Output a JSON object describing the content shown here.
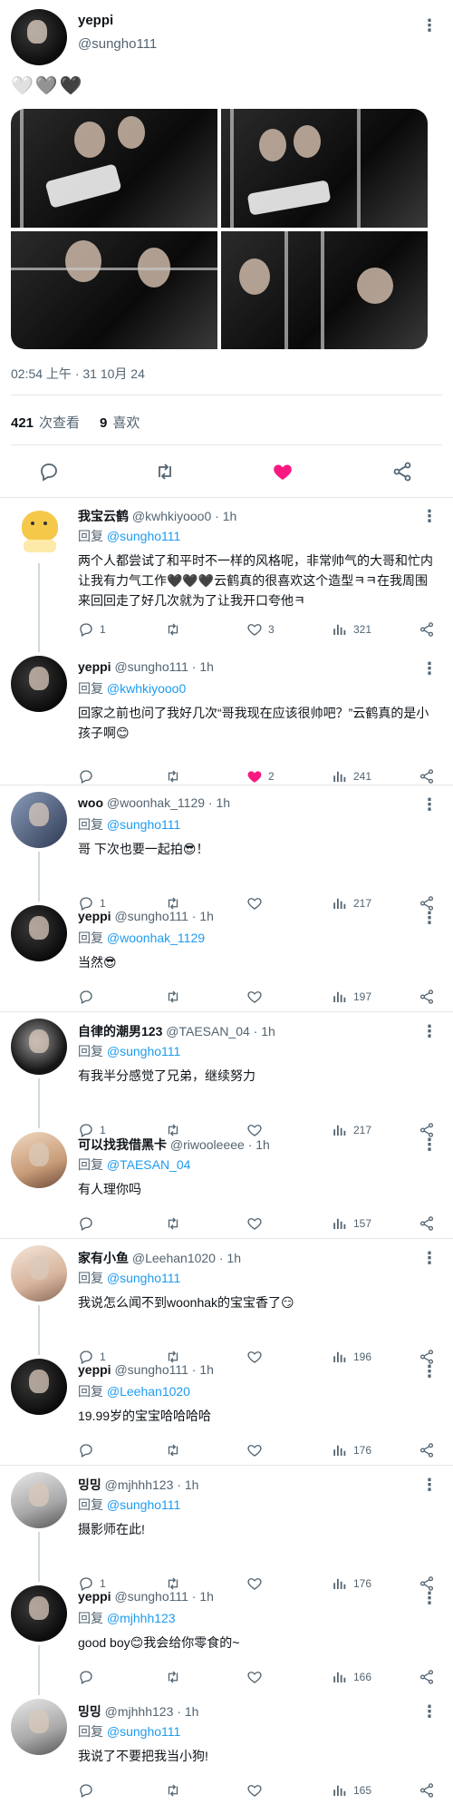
{
  "post": {
    "author_name": "yeppi",
    "author_handle": "@sungho111",
    "text": "🤍🩶🖤",
    "timestamp": "02:54 上午 · 31 10月 24",
    "views_count": "421",
    "views_label": "次查看",
    "likes_count": "9",
    "likes_label": "喜欢",
    "liked": true,
    "like_color": "#f91880"
  },
  "colors": {
    "link": "#1d9bf0",
    "muted": "#536471",
    "like": "#f91880"
  },
  "replies": [
    {
      "name": "我宝云鹤",
      "handle": "@kwhkiyooo0",
      "time": "1h",
      "replyto_prefix": "回复",
      "replyto": "@sungho111",
      "text": "两个人都尝试了和平时不一样的风格呢，非常帅气的大哥和忙内让我有力气工作🖤🖤🖤云鹤真的很喜欢这个造型ㅋㅋ在我周围来回回走了好几次就为了让我开口夸他ㅋ",
      "reply_count": "1",
      "retweet_count": "",
      "like_count": "3",
      "liked": false,
      "views": "321"
    },
    {
      "name": "yeppi",
      "handle": "@sungho111",
      "time": "1h",
      "replyto_prefix": "回复",
      "replyto": "@kwhkiyooo0",
      "text": "回家之前也问了我好几次“哥我现在应该很帅吧？”云鹤真的是小孩子啊😊",
      "reply_count": "",
      "retweet_count": "",
      "like_count": "2",
      "liked": true,
      "views": "241"
    },
    {
      "name": "woo",
      "handle": "@woonhak_1129",
      "time": "1h",
      "replyto_prefix": "回复",
      "replyto": "@sungho111",
      "text": "哥 下次也要一起拍😎！",
      "reply_count": "1",
      "retweet_count": "",
      "like_count": "",
      "liked": false,
      "views": "217"
    },
    {
      "name": "yeppi",
      "handle": "@sungho111",
      "time": "1h",
      "replyto_prefix": "回复",
      "replyto": "@woonhak_1129",
      "text": "当然😎",
      "reply_count": "",
      "retweet_count": "",
      "like_count": "",
      "liked": false,
      "views": "197"
    },
    {
      "name": "自律的潮男123",
      "handle": "@TAESAN_04",
      "time": "1h",
      "replyto_prefix": "回复",
      "replyto": "@sungho111",
      "text": "有我半分感觉了兄弟，继续努力",
      "reply_count": "1",
      "retweet_count": "",
      "like_count": "",
      "liked": false,
      "views": "217"
    },
    {
      "name": "可以找我借黑卡",
      "handle": "@riwooleeee",
      "time": "1h",
      "replyto_prefix": "回复",
      "replyto": "@TAESAN_04",
      "text": "有人理你吗",
      "reply_count": "",
      "retweet_count": "",
      "like_count": "",
      "liked": false,
      "views": "157"
    },
    {
      "name": "家有小鱼",
      "handle": "@Leehan1020",
      "time": "1h",
      "replyto_prefix": "回复",
      "replyto": "@sungho111",
      "text": "我说怎么闻不到woonhak的宝宝香了😏",
      "reply_count": "1",
      "retweet_count": "",
      "like_count": "",
      "liked": false,
      "views": "196"
    },
    {
      "name": "yeppi",
      "handle": "@sungho111",
      "time": "1h",
      "replyto_prefix": "回复",
      "replyto": "@Leehan1020",
      "text": "19.99岁的宝宝哈哈哈哈",
      "reply_count": "",
      "retweet_count": "",
      "like_count": "",
      "liked": false,
      "views": "176"
    },
    {
      "name": "밍밍",
      "handle": "@mjhhh123",
      "time": "1h",
      "replyto_prefix": "回复",
      "replyto": "@sungho111",
      "text": "摄影师在此!",
      "reply_count": "1",
      "retweet_count": "",
      "like_count": "",
      "liked": false,
      "views": "176"
    },
    {
      "name": "yeppi",
      "handle": "@sungho111",
      "time": "1h",
      "replyto_prefix": "回复",
      "replyto": "@mjhhh123",
      "text": "good boy😊我会给你零食的~",
      "reply_count": "",
      "retweet_count": "",
      "like_count": "",
      "liked": false,
      "views": "166"
    },
    {
      "name": "밍밍",
      "handle": "@mjhhh123",
      "time": "1h",
      "replyto_prefix": "回复",
      "replyto": "@sungho111",
      "text": "我说了不要把我当小狗!",
      "reply_count": "",
      "retweet_count": "",
      "like_count": "",
      "liked": false,
      "views": "165"
    }
  ]
}
